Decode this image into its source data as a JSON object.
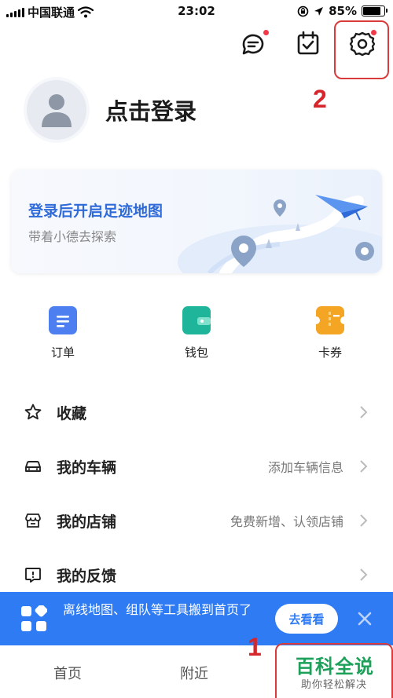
{
  "status_bar": {
    "carrier": "中国联通",
    "time": "23:02",
    "battery_percent": "85%",
    "battery_level": 0.85,
    "icons": [
      "signal-icon",
      "wifi-icon",
      "orientation-lock-icon",
      "location-arrow-icon",
      "battery-icon"
    ]
  },
  "header": {
    "icons": [
      "message-icon",
      "checkin-calendar-icon",
      "settings-gear-icon"
    ]
  },
  "annotations": {
    "settings_step": "2",
    "tab_step": "1"
  },
  "profile": {
    "login_text": "点击登录"
  },
  "footprint_card": {
    "title": "登录后开启足迹地图",
    "subtitle": "带着小德去探索"
  },
  "quick_actions": [
    {
      "label": "订单",
      "icon": "order-icon",
      "color": "#4d7ff0"
    },
    {
      "label": "钱包",
      "icon": "wallet-icon",
      "color": "#1fb59a"
    },
    {
      "label": "卡券",
      "icon": "coupon-icon",
      "color": "#f5a524"
    }
  ],
  "menu": [
    {
      "label": "收藏",
      "hint": "",
      "icon": "star-icon"
    },
    {
      "label": "我的车辆",
      "hint": "添加车辆信息",
      "icon": "car-icon"
    },
    {
      "label": "我的店铺",
      "hint": "免费新增、认领店铺",
      "icon": "store-icon"
    },
    {
      "label": "我的反馈",
      "hint": "",
      "icon": "feedback-icon"
    }
  ],
  "promo": {
    "text": "离线地图、组队等工具搬到首页了",
    "button": "去看看",
    "accent": "#2f7bf4"
  },
  "tabs": [
    {
      "label": "首页"
    },
    {
      "label": "附近"
    }
  ],
  "watermark": {
    "title": "百科全说",
    "subtitle": "助你轻松解决"
  }
}
